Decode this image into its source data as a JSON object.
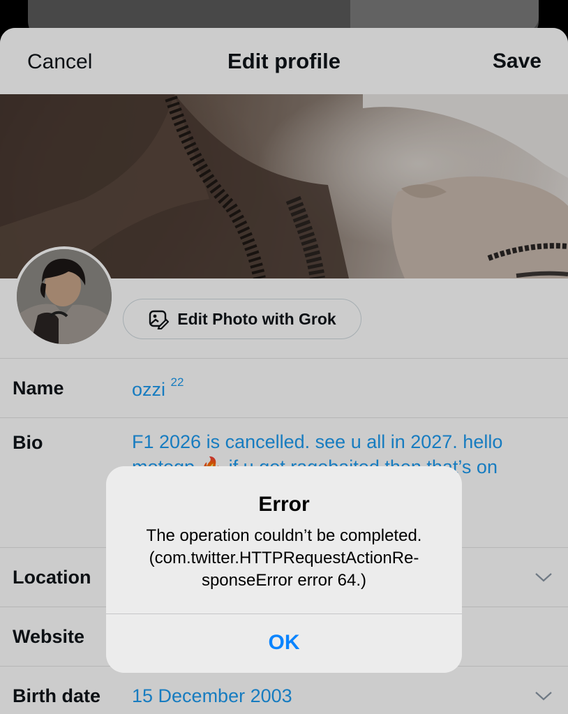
{
  "nav": {
    "cancel_label": "Cancel",
    "title": "Edit profile",
    "save_label": "Save"
  },
  "grok_button": {
    "label": "Edit Photo with Grok",
    "icon": "photo-edit-icon"
  },
  "fields": {
    "name": {
      "label": "Name",
      "value": "ozzi",
      "superscript": "22"
    },
    "bio": {
      "label": "Bio",
      "value": "F1 2026 is cancelled. see u all in 2027. hello motogp 🔥 if u got ragebaited then that’s on"
    },
    "location": {
      "label": "Location",
      "icon": "chevron-down-icon"
    },
    "website": {
      "label": "Website"
    },
    "birth_date": {
      "label": "Birth date",
      "value": "15 December 2003",
      "icon": "chevron-down-icon"
    }
  },
  "alert": {
    "title": "Error",
    "message_lines": [
      "The operation couldn’t be completed.",
      "(com.twitter.HTTPRequestActionRe-",
      "sponseError error 64.)"
    ],
    "ok_label": "OK"
  },
  "colors": {
    "accent_blue": "#1d9bf0",
    "alert_ok_blue": "#0a84ff",
    "text_primary": "#0f1419",
    "divider": "#e4e4e4"
  }
}
